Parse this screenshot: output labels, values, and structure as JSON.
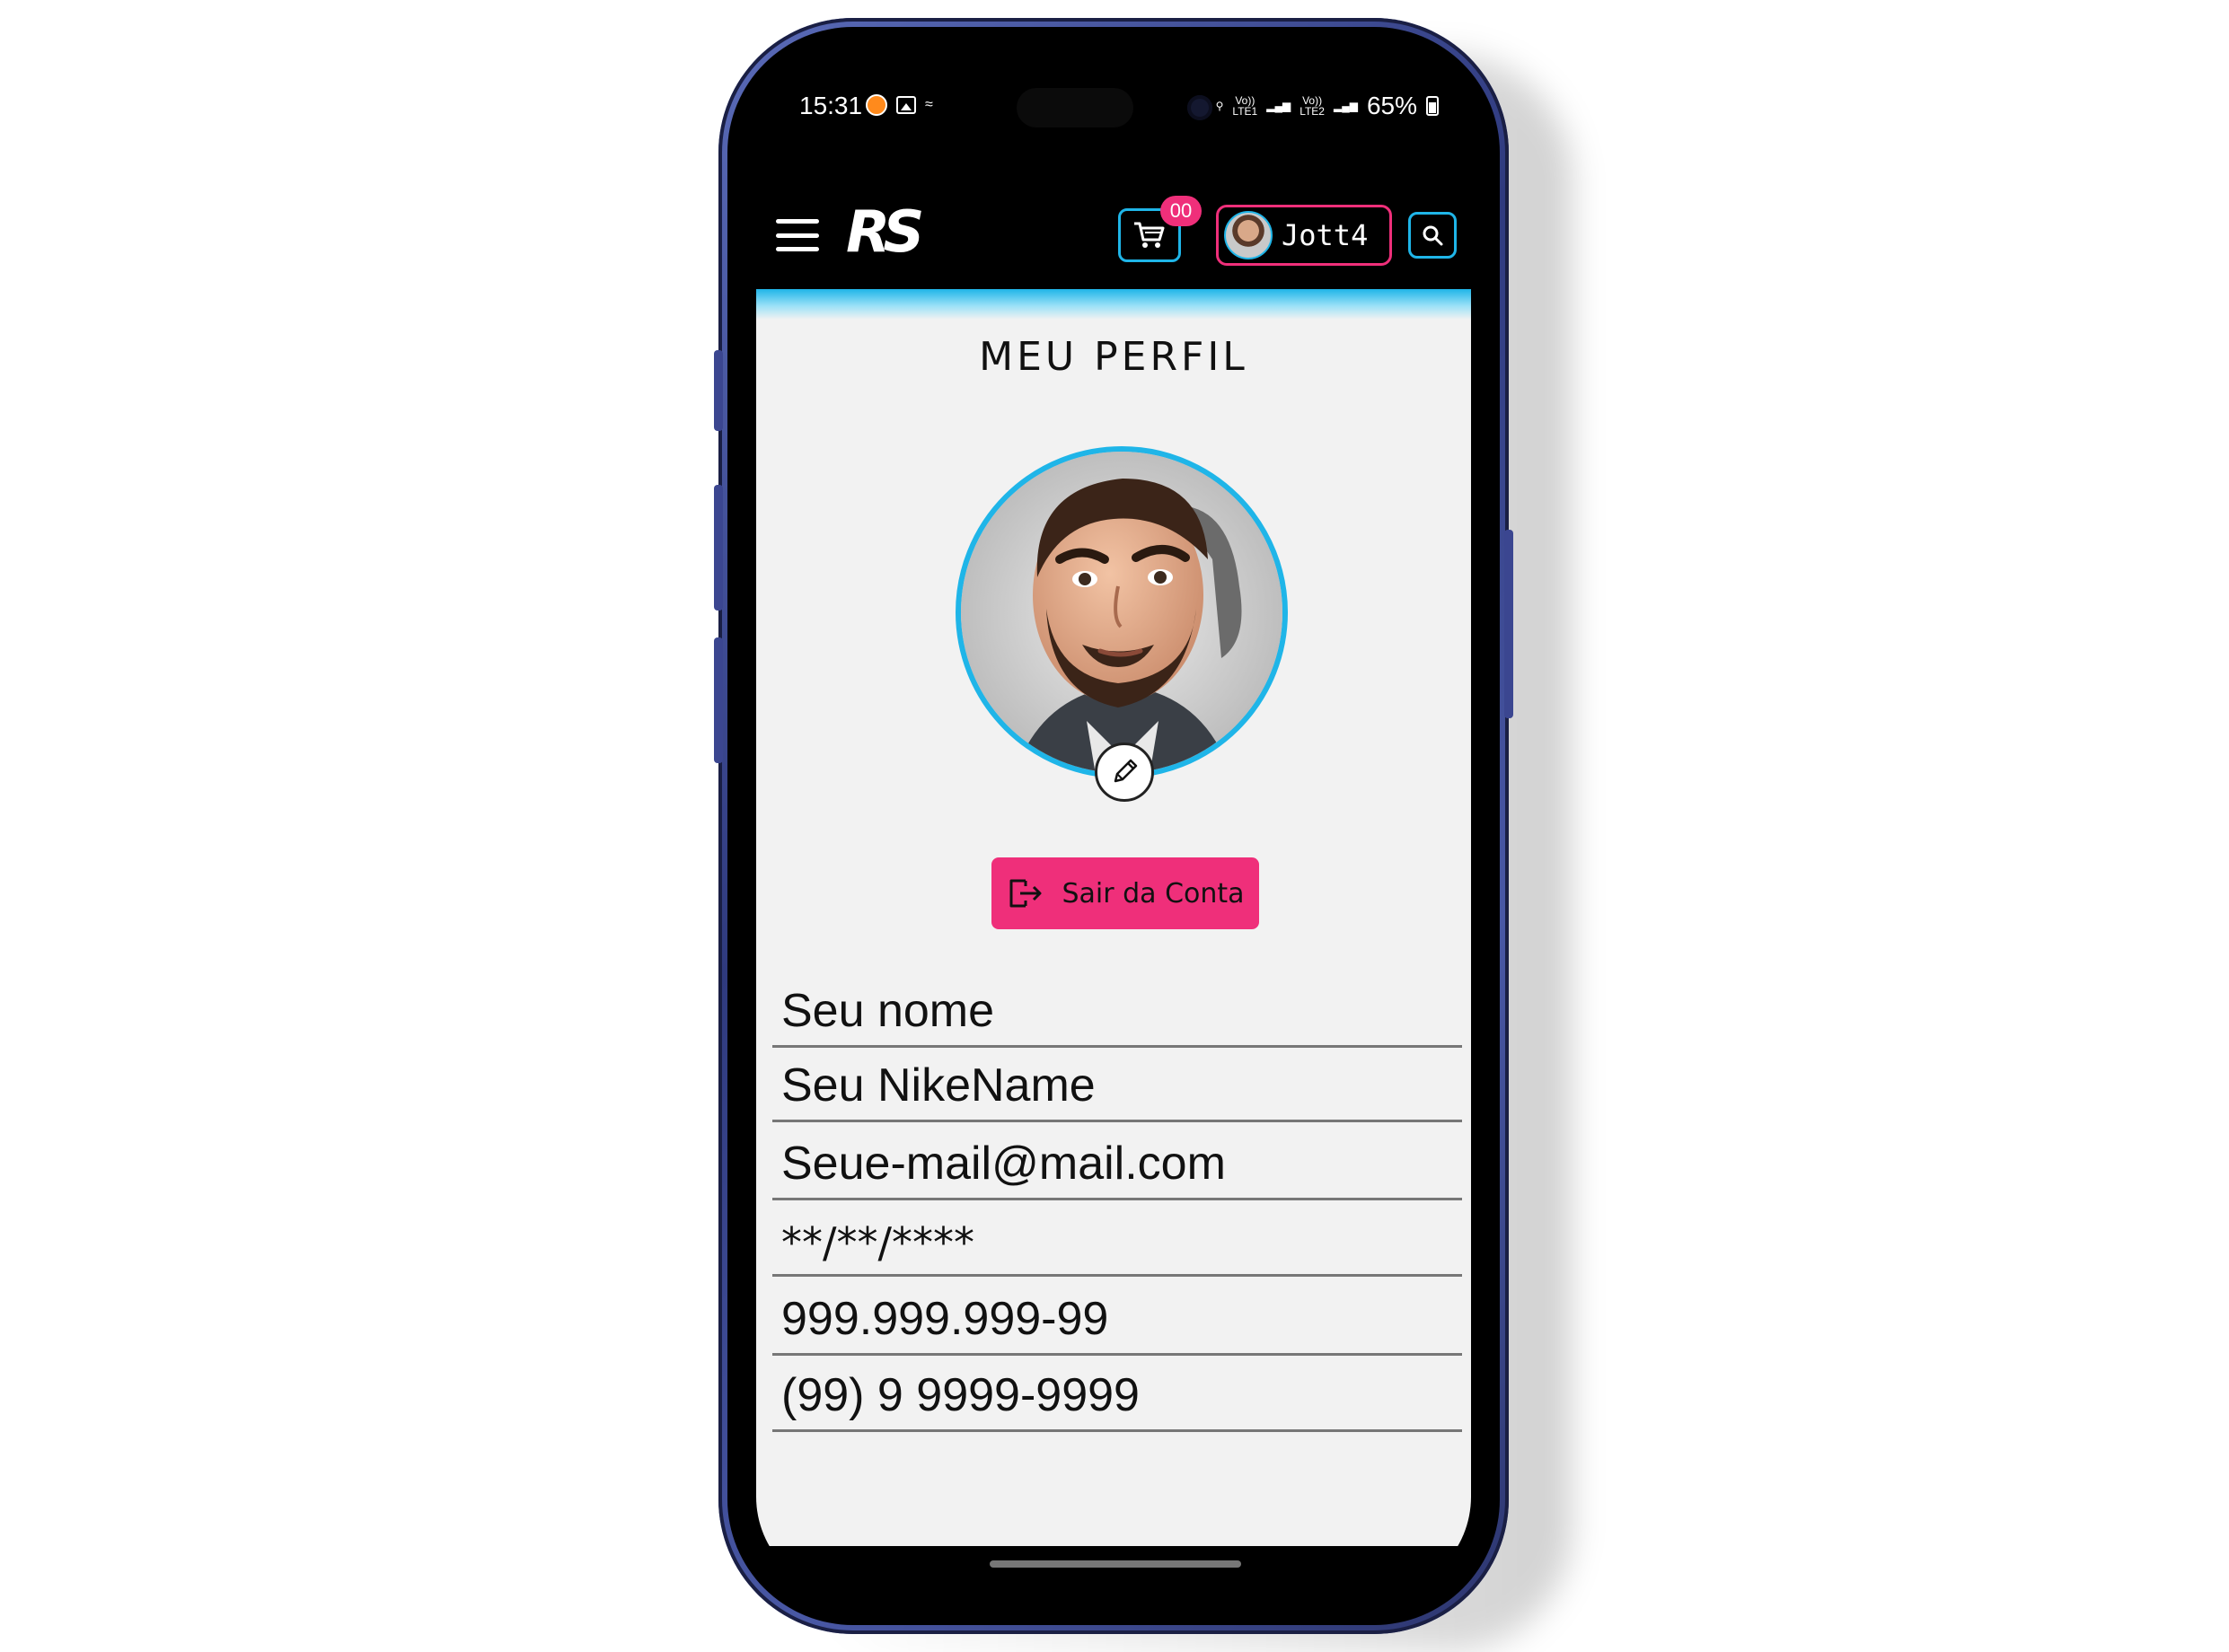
{
  "status_bar": {
    "time": "15:31",
    "battery": "65%",
    "signal_1": "Vo))\nLTE1",
    "signal_2": "Vo))\nLTE2"
  },
  "header": {
    "logo": "RS",
    "cart_badge": "00",
    "user_name": "Jott4"
  },
  "profile": {
    "title": "MEU PERFIL",
    "logout_label": "Sair da Conta",
    "fields": {
      "name": "Seu nome",
      "nickname": "Seu NikeName",
      "email": "Seue-mail@mail.com",
      "birthdate": "**/**/****",
      "cpf": "999.999.999-99",
      "phone": "(99) 9 9999-9999"
    }
  },
  "colors": {
    "accent_cyan": "#1fb5e8",
    "accent_pink": "#ef2f7a",
    "frame_blue": "#3b4690"
  },
  "icons": [
    "menu-icon",
    "cart-icon",
    "search-icon",
    "pencil-icon",
    "logout-icon"
  ]
}
